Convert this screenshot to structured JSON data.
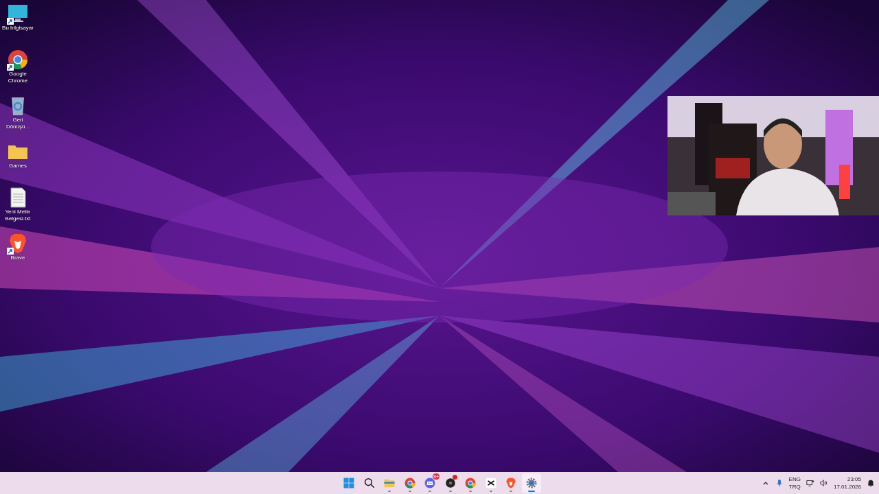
{
  "desktop_icons": [
    {
      "kind": "computer",
      "label": "Bu bilgisayar",
      "shortcut": true
    },
    {
      "kind": "chrome",
      "label": "Google Chrome",
      "shortcut": true
    },
    {
      "kind": "recycle",
      "label": "Geri Dönüşü...",
      "shortcut": false
    },
    {
      "kind": "folder",
      "label": "Games",
      "shortcut": false
    },
    {
      "kind": "text",
      "label": "Yeni Metin Belgesi.txt",
      "shortcut": false
    },
    {
      "kind": "brave",
      "label": "Brave",
      "shortcut": true
    }
  ],
  "taskbar": {
    "apps": [
      {
        "kind": "start",
        "running": false,
        "active": false
      },
      {
        "kind": "search",
        "running": false,
        "active": false
      },
      {
        "kind": "explorer",
        "running": true,
        "active": false
      },
      {
        "kind": "chrome",
        "running": true,
        "active": false
      },
      {
        "kind": "discord",
        "running": true,
        "active": false,
        "badge": "9+"
      },
      {
        "kind": "dark-app",
        "running": true,
        "active": false,
        "alert": true
      },
      {
        "kind": "chrome",
        "running": true,
        "active": false
      },
      {
        "kind": "capcut",
        "running": true,
        "active": false
      },
      {
        "kind": "brave",
        "running": true,
        "active": false
      },
      {
        "kind": "settings",
        "running": true,
        "active": true
      }
    ],
    "tray": {
      "language": "ENG",
      "layout": "TRQ",
      "time": "23:05",
      "date": "17.01.2026"
    }
  }
}
